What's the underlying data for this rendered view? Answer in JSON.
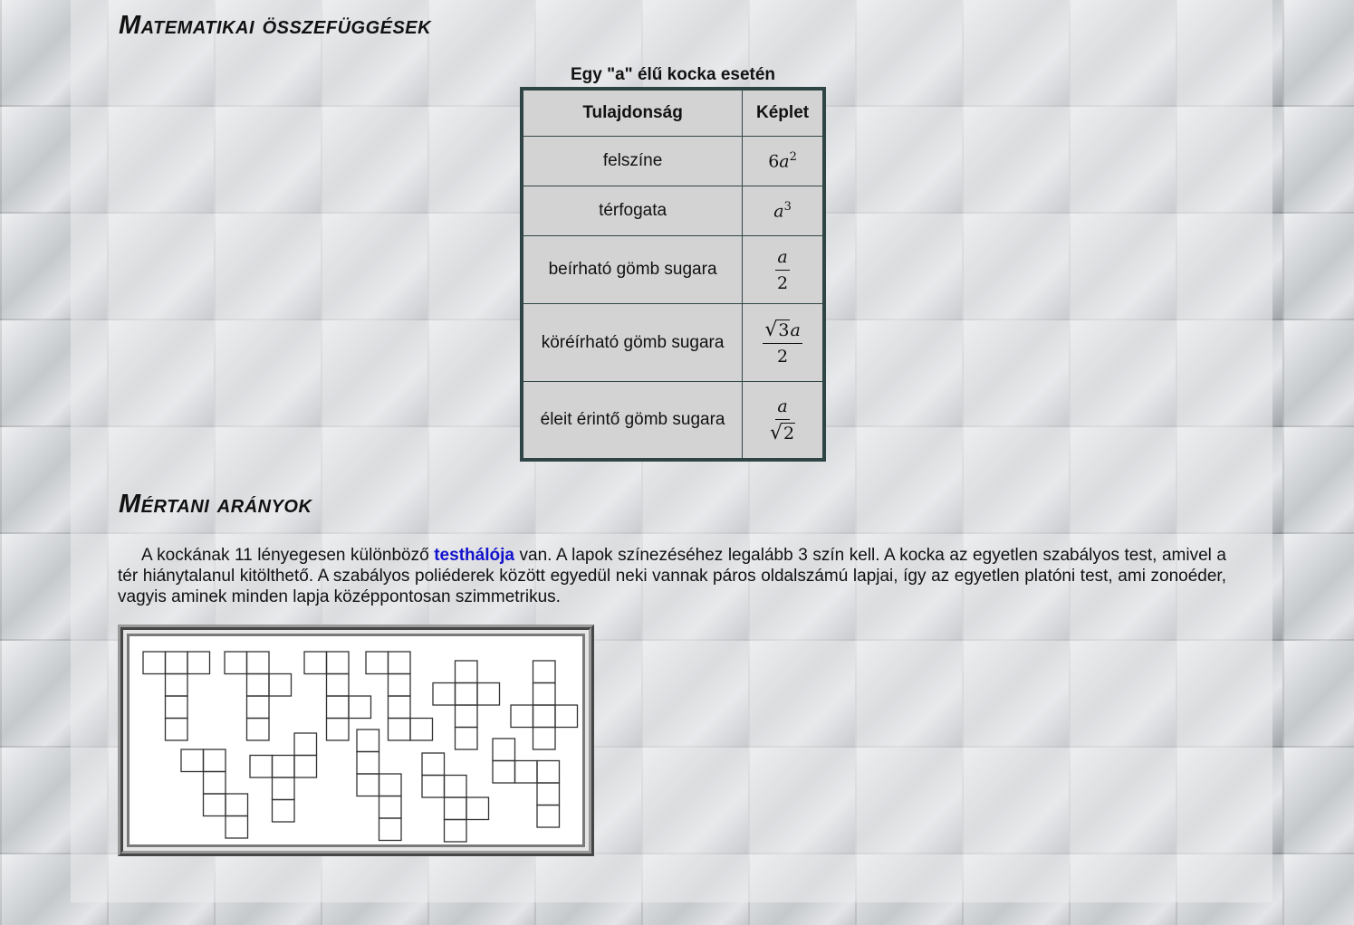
{
  "titles": {
    "relations": "Matematikai összefüggések",
    "proportions": "Mértani arányok"
  },
  "table": {
    "caption": "Egy \"a\" élű kocka esetén",
    "header": {
      "property": "Tulajdonság",
      "formula": "Képlet"
    },
    "rows": [
      {
        "property": "felszíne",
        "formula": "6a²"
      },
      {
        "property": "térfogata",
        "formula": "a³"
      },
      {
        "property": "beírható gömb sugara",
        "formula": "a/2"
      },
      {
        "property": "köréírható gömb sugara",
        "formula": "√3a/2"
      },
      {
        "property": "éleit érintő gömb sugara",
        "formula": "a/√2"
      }
    ]
  },
  "paragraph": {
    "before_link": "A kockának 11 lényegesen különböző ",
    "link": "testhálója",
    "after_link": " van. A lapok színezéséhez legalább 3 szín kell. A kocka az egyetlen szabályos test, amivel a tér hiánytalanul kitölthető. A szabályos poliéderek között egyedül neki vannak páros oldalszámú lapjai, így az egyetlen platóni test, ami zonoéder, vagyis aminek minden lapja középpontosan szimmetrikus."
  },
  "figure": {
    "content": "11 cube nets"
  },
  "colors": {
    "link": "#1212cc",
    "table_border": "#2f4545",
    "table_bg": "#d3d3d3"
  }
}
